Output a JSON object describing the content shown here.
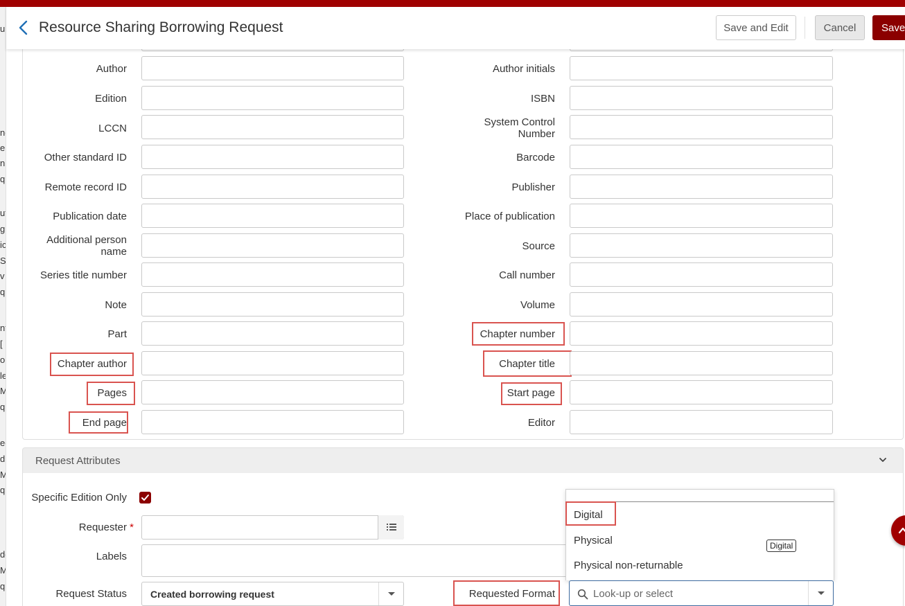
{
  "header": {
    "title": "Resource Sharing Borrowing Request",
    "save_and_edit": "Save and Edit",
    "cancel": "Cancel",
    "save": "Save"
  },
  "left_strip": [
    "u",
    "ne",
    "e",
    "n",
    "q",
    "ut",
    "g",
    "ic",
    "S",
    "v",
    "q",
    "nt",
    "[",
    "oi",
    "le",
    "M",
    "q",
    "ec",
    "d",
    "M",
    "q",
    "dg",
    "M",
    "q"
  ],
  "form": {
    "author": "Author",
    "author_initials": "Author initials",
    "edition": "Edition",
    "isbn": "ISBN",
    "lccn": "LCCN",
    "system_control_number": "System Control Number",
    "other_standard_id": "Other standard ID",
    "barcode": "Barcode",
    "remote_record_id": "Remote record ID",
    "publisher": "Publisher",
    "publication_date": "Publication date",
    "place_of_publication": "Place of publication",
    "additional_person_name": "Additional person name",
    "source": "Source",
    "series_title_number": "Series title number",
    "call_number": "Call number",
    "note": "Note",
    "volume": "Volume",
    "part": "Part",
    "chapter_number": "Chapter number",
    "chapter_author": "Chapter author",
    "chapter_title": "Chapter title",
    "pages": "Pages",
    "start_page": "Start page",
    "end_page": "End page",
    "editor": "Editor"
  },
  "request_attributes": {
    "section_title": "Request Attributes",
    "specific_edition_only": "Specific Edition Only",
    "specific_edition_checked": true,
    "requester": "Requester",
    "required_mark": "*",
    "labels": "Labels",
    "request_status": "Request Status",
    "request_status_value": "Created borrowing request",
    "requested_format": "Requested Format",
    "format_placeholder": "Look-up or select",
    "format_options": [
      "Digital",
      "Physical",
      "Physical non-returnable"
    ],
    "tooltip": "Digital"
  },
  "colors": {
    "brand": "#a00000",
    "highlight": "#d9534f",
    "link": "#1f6fb5"
  }
}
